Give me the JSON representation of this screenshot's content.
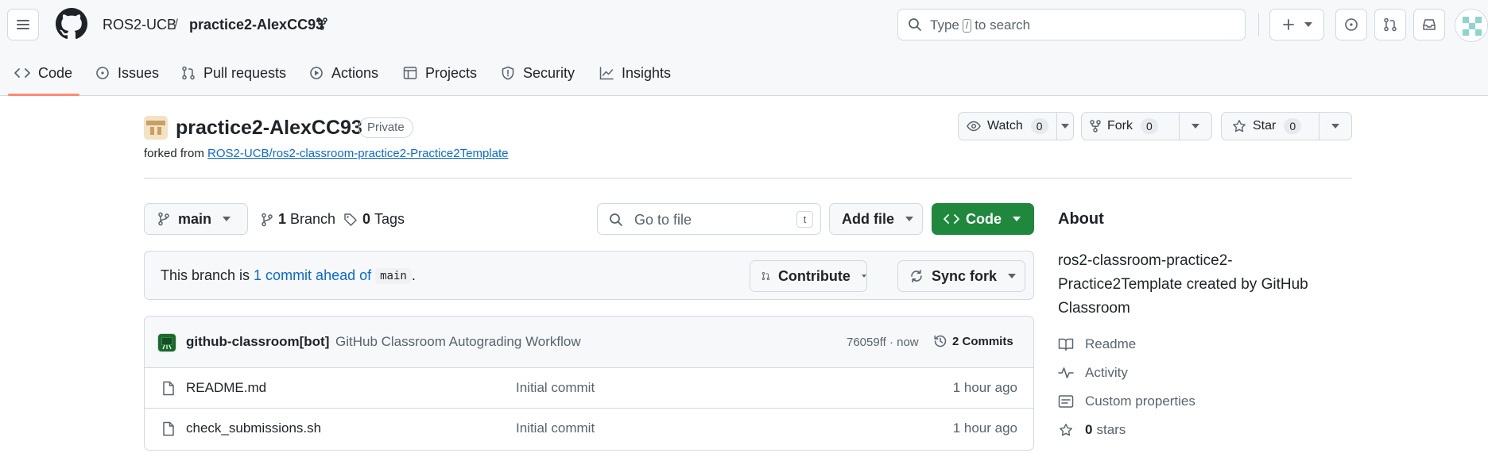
{
  "header": {
    "owner": "ROS2-UCB",
    "separator": "/",
    "repo": "practice2-AlexCC93",
    "search_prefix": "Type",
    "search_key": "/",
    "search_suffix": "to search"
  },
  "tabs": [
    {
      "label": "Code",
      "icon": "code-icon"
    },
    {
      "label": "Issues",
      "icon": "issue-icon"
    },
    {
      "label": "Pull requests",
      "icon": "pull-request-icon"
    },
    {
      "label": "Actions",
      "icon": "play-icon"
    },
    {
      "label": "Projects",
      "icon": "table-icon"
    },
    {
      "label": "Security",
      "icon": "shield-icon"
    },
    {
      "label": "Insights",
      "icon": "graph-icon"
    }
  ],
  "repo": {
    "title": "practice2-AlexCC93",
    "visibility": "Private",
    "forked_prefix": "forked from",
    "forked_from": "ROS2-UCB/ros2-classroom-practice2-Practice2Template",
    "watch_label": "Watch",
    "watch_count": "0",
    "fork_label": "Fork",
    "fork_count": "0",
    "star_label": "Star",
    "star_count": "0"
  },
  "branch": {
    "current": "main",
    "branch_count": "1",
    "branch_label": "Branch",
    "tag_count": "0",
    "tag_label": "Tags",
    "goto_placeholder": "Go to file",
    "goto_key": "t",
    "add_file": "Add file",
    "code_button": "Code"
  },
  "banner": {
    "prefix": "This branch is",
    "link": "1 commit ahead of",
    "base": "main",
    "suffix": ".",
    "contribute": "Contribute",
    "sync": "Sync fork"
  },
  "latest_commit": {
    "author": "github-classroom[bot]",
    "message": "GitHub Classroom Autograding Workflow",
    "hash_time": "76059ff · now",
    "commits": "2 Commits"
  },
  "files": [
    {
      "name": "README.md",
      "message": "Initial commit",
      "time": "1 hour ago"
    },
    {
      "name": "check_submissions.sh",
      "message": "Initial commit",
      "time": "1 hour ago"
    }
  ],
  "about": {
    "heading": "About",
    "description": "ros2-classroom-practice2-Practice2Template created by GitHub Classroom",
    "readme": "Readme",
    "activity": "Activity",
    "custom_properties": "Custom properties",
    "stars_count": "0",
    "stars_label": "stars"
  },
  "colors": {
    "accent_green": "#1f883d",
    "link_blue": "#0969da",
    "tab_underline": "#fd8c73"
  }
}
